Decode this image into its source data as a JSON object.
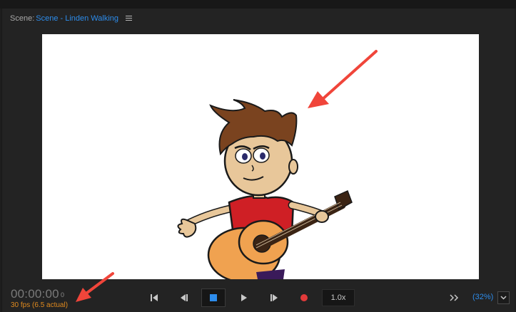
{
  "header": {
    "scene_label": "Scene:",
    "scene_name": "Scene - Linden Walking"
  },
  "status": {
    "timecode": "00:00:00",
    "frame": "0",
    "fps": "30 fps (6.5 actual)"
  },
  "transport": {
    "speed": "1.0x",
    "zoom": "(32%)"
  },
  "colors": {
    "accent": "#2d8ceb",
    "fps_text": "#e08a1e",
    "record": "#e23a3a",
    "annotation_arrow": "#f0453a"
  },
  "icons": [
    "menu-icon",
    "skip-to-start-icon",
    "step-back-icon",
    "stop-icon",
    "play-icon",
    "step-forward-icon",
    "record-icon",
    "double-chevron-right-icon",
    "chevron-down-icon"
  ]
}
